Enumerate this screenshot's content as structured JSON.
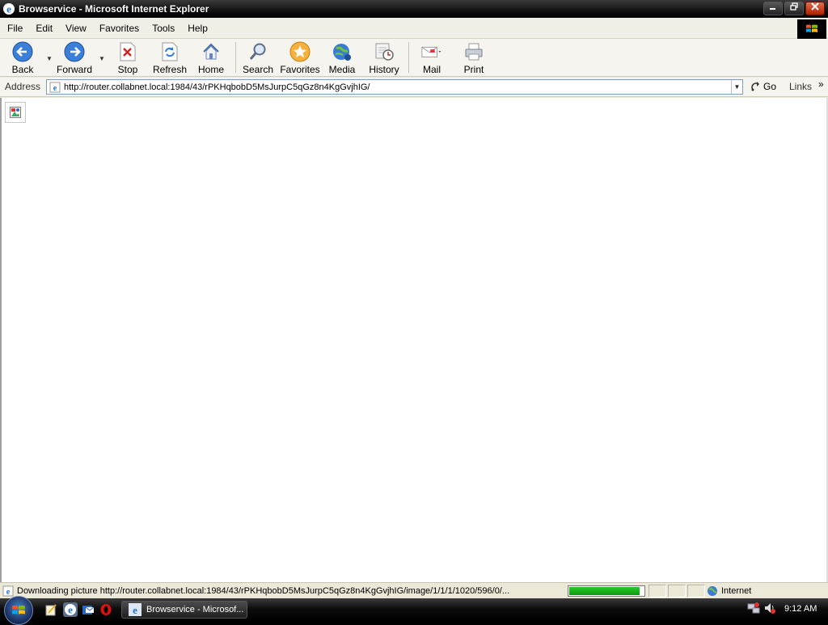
{
  "window": {
    "title": "Browservice - Microsoft Internet Explorer",
    "controls": [
      "minimize",
      "restore",
      "close"
    ]
  },
  "menu": [
    {
      "label": "File"
    },
    {
      "label": "Edit"
    },
    {
      "label": "View"
    },
    {
      "label": "Favorites"
    },
    {
      "label": "Tools"
    },
    {
      "label": "Help"
    }
  ],
  "toolbar": {
    "back": "Back",
    "forward": "Forward",
    "stop": "Stop",
    "refresh": "Refresh",
    "home": "Home",
    "search": "Search",
    "favorites": "Favorites",
    "media": "Media",
    "history": "History",
    "mail": "Mail",
    "print": "Print"
  },
  "address": {
    "label": "Address",
    "url": "http://router.collabnet.local:1984/43/rPKHqbobD5MsJurpC5qGz8n4KgGvjhIG/",
    "go": "Go",
    "links": "Links"
  },
  "status": {
    "text": "Downloading picture http://router.collabnet.local:1984/43/rPKHqbobD5MsJurpC5qGz8n4KgGvjhIG/image/1/1/1/1020/596/0/...",
    "progress_percent": 95,
    "zone": "Internet"
  },
  "taskbar": {
    "task_label": "Browservice - Microsof...",
    "clock": "9:12 AM"
  },
  "colors": {
    "progress": "#10a010",
    "title_bar": "#111111",
    "ie_blue": "#1e6fd0"
  }
}
